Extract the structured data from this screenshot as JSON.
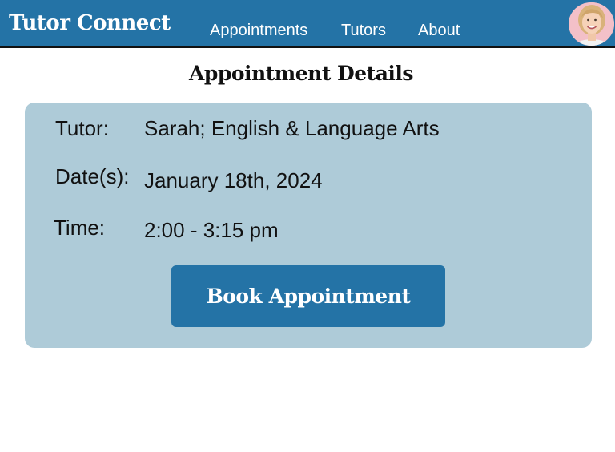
{
  "nav": {
    "brand": "Tutor Connect",
    "links": [
      "Appointments",
      "Tutors",
      "About"
    ]
  },
  "avatar": {
    "icon": "user-avatar"
  },
  "page_title": "Appointment Details",
  "details": {
    "tutor_label": "Tutor:",
    "tutor_value": "Sarah; English & Language Arts",
    "date_label": "Date(s):",
    "date_value": "January 18th, 2024",
    "time_label": "Time:",
    "time_value": "2:00 - 3:15 pm"
  },
  "book_button_label": "Book Appointment",
  "colors": {
    "primary": "#2473a6",
    "card_background": "#aecbd8",
    "avatar_background": "#f3c0c8"
  }
}
